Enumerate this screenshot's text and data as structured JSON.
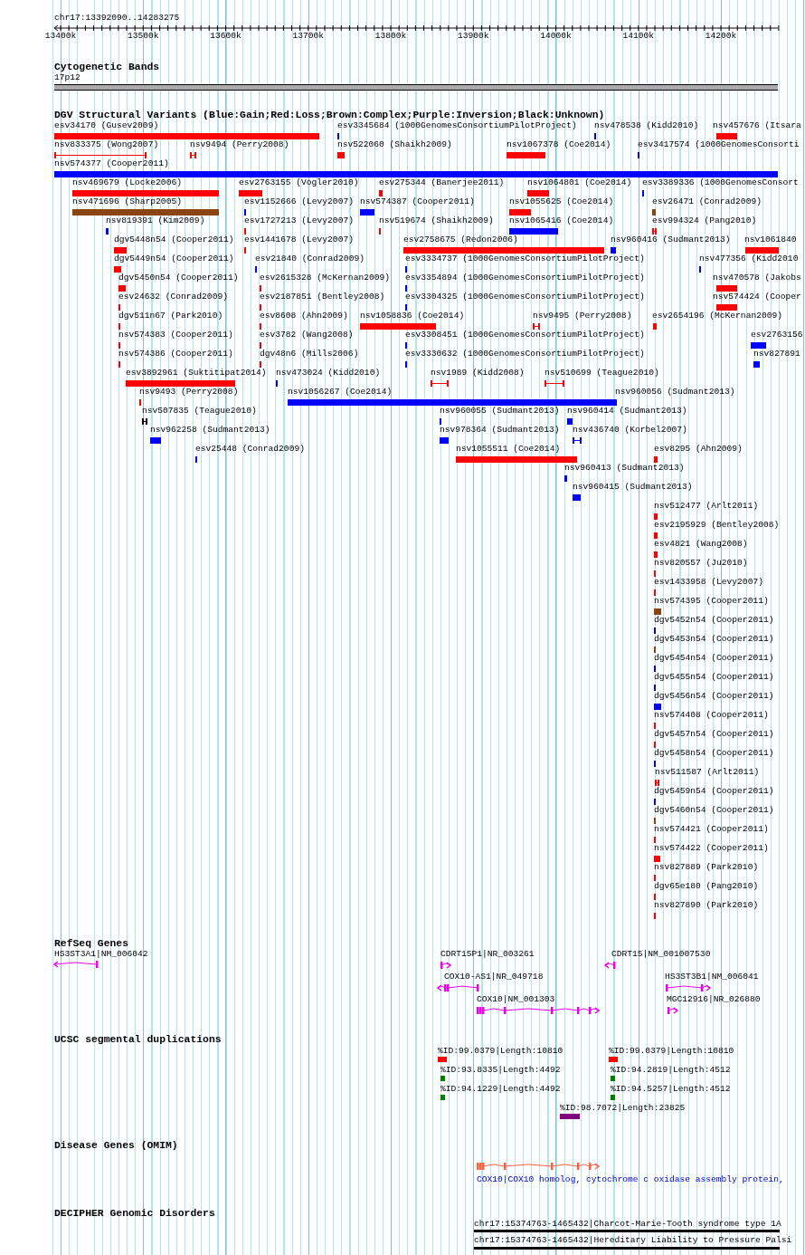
{
  "position": "chr17:13392090..14283275",
  "ruler": {
    "ticks": [
      "13400k",
      "13500k",
      "13600k",
      "13700k",
      "13800k",
      "13900k",
      "14000k",
      "14100k",
      "14200k"
    ]
  },
  "cytogenetic_bands": {
    "title": "Cytogenetic Bands",
    "bands": [
      {
        "label": "17p12"
      }
    ]
  },
  "dgv_variants": {
    "title": "DGV Structural Variants (Blue:Gain;Red:Loss;Brown:Complex;Purple:Inversion;Black:Unknown)",
    "rows": [
      [
        {
          "label": "esv34170 (Gusev2009)",
          "color": "#ff0000"
        },
        {
          "label": "esv3345684 (1000GenomesConsortiumPilotProject)",
          "color": "#0000ff"
        },
        {
          "label": "nsv478538 (Kidd2010)",
          "color": "#0000ff"
        },
        {
          "label": "nsv457676 (Itsara",
          "color": "#ff0000"
        }
      ],
      [
        {
          "label": "nsv833375 (Wong2007)",
          "color": "#ff0000"
        },
        {
          "label": "nsv9494 (Perry2008)",
          "color": "#ff0000"
        },
        {
          "label": "nsv522060 (Shaikh2009)",
          "color": "#ff0000"
        },
        {
          "label": "nsv1067378 (Coe2014)",
          "color": "#ff0000"
        },
        {
          "label": "esv3417574 (1000GenomesConsorti",
          "color": "#0000ff"
        }
      ],
      [
        {
          "label": "nsv574377 (Cooper2011)",
          "color": "#0000ff"
        }
      ],
      [
        {
          "label": "nsv469679 (Locke2006)",
          "color": "#ff0000"
        },
        {
          "label": "esv2763155 (Vogler2010)",
          "color": "#ff0000"
        },
        {
          "label": "esv275344 (Banerjee2011)",
          "color": "#ff0000"
        },
        {
          "label": "nsv1064801 (Coe2014)",
          "color": "#ff0000"
        },
        {
          "label": "esv3389336 (1000GenomesConsort",
          "color": "#0000ff"
        }
      ],
      [
        {
          "label": "nsv471696 (Sharp2005)",
          "color": "#8b4513"
        },
        {
          "label": "esv1152666 (Levy2007)",
          "color": "#0000ff"
        },
        {
          "label": "nsv574387 (Cooper2011)",
          "color": "#0000ff"
        },
        {
          "label": "nsv1055625 (Coe2014)",
          "color": "#ff0000"
        },
        {
          "label": "esv26471 (Conrad2009)",
          "color": "#8b4513"
        }
      ],
      [
        {
          "label": "nsv819391 (Kim2009)",
          "color": "#0000ff"
        },
        {
          "label": "esv1727213 (Levy2007)",
          "color": "#ff0000"
        },
        {
          "label": "nsv519674 (Shaikh2009)",
          "color": "#ff0000"
        },
        {
          "label": "nsv1065416 (Coe2014)",
          "color": "#0000ff"
        },
        {
          "label": "esv994324 (Pang2010)",
          "color": "#ff0000"
        }
      ],
      [
        {
          "label": "dgv5448n54 (Cooper2011)",
          "color": "#ff0000"
        },
        {
          "label": "esv1441678 (Levy2007)",
          "color": "#ff0000"
        },
        {
          "label": "esv2758675 (Redon2006)",
          "color": "#ff0000"
        },
        {
          "label": "nsv960416 (Sudmant2013)",
          "color": "#0000ff"
        },
        {
          "label": "nsv1061840",
          "color": "#ff0000"
        }
      ],
      [
        {
          "label": "dgv5449n54 (Cooper2011)",
          "color": "#ff0000"
        },
        {
          "label": "esv21840 (Conrad2009)",
          "color": "#0000ff"
        },
        {
          "label": "esv3334737 (1000GenomesConsortiumPilotProject)",
          "color": "#0000ff"
        },
        {
          "label": "nsv477356 (Kidd2010",
          "color": "#0000ff"
        }
      ],
      [
        {
          "label": "dgv5450n54 (Cooper2011)",
          "color": "#ff0000"
        },
        {
          "label": "esv2615328 (McKernan2009)",
          "color": "#ff0000"
        },
        {
          "label": "esv3354894 (1000GenomesConsortiumPilotProject)",
          "color": "#0000ff"
        },
        {
          "label": "nsv470578 (Jakobs",
          "color": "#ff0000"
        }
      ],
      [
        {
          "label": "esv24632 (Conrad2009)",
          "color": "#ff0000"
        },
        {
          "label": "esv2187851 (Bentley2008)",
          "color": "#ff0000"
        },
        {
          "label": "esv3304325 (1000GenomesConsortiumPilotProject)",
          "color": "#0000ff"
        },
        {
          "label": "nsv574424 (Cooper",
          "color": "#ff0000"
        }
      ],
      [
        {
          "label": "dgv511n67 (Park2010)",
          "color": "#ff0000"
        },
        {
          "label": "esv8608 (Ahn2009)",
          "color": "#ff0000"
        },
        {
          "label": "nsv1058836 (Coe2014)",
          "color": "#ff0000"
        },
        {
          "label": "nsv9495 (Perry2008)",
          "color": "#ff0000"
        },
        {
          "label": "esv2654196 (McKernan2009)",
          "color": "#ff0000"
        }
      ],
      [
        {
          "label": "nsv574383 (Cooper2011)",
          "color": "#ff0000"
        },
        {
          "label": "esv3782 (Wang2008)",
          "color": "#ff0000"
        },
        {
          "label": "esv3308451 (1000GenomesConsortiumPilotProject)",
          "color": "#0000ff"
        },
        {
          "label": "esv2763156",
          "color": "#0000ff"
        }
      ],
      [
        {
          "label": "nsv574386 (Cooper2011)",
          "color": "#ff0000"
        },
        {
          "label": "dgv48n6 (Mills2006)",
          "color": "#ff0000"
        },
        {
          "label": "esv3330632 (1000GenomesConsortiumPilotProject)",
          "color": "#0000ff"
        },
        {
          "label": "nsv827891",
          "color": "#0000ff"
        }
      ],
      [
        {
          "label": "esv3892961 (Suktitipat2014)",
          "color": "#ff0000"
        },
        {
          "label": "nsv473024 (Kidd2010)",
          "color": "#0000ff"
        },
        {
          "label": "nsv1989 (Kidd2008)",
          "color": "#ff0000"
        },
        {
          "label": "nsv510699 (Teague2010)",
          "color": "#ff0000"
        }
      ],
      [
        {
          "label": "nsv9493 (Perry2008)",
          "color": "#ff0000"
        },
        {
          "label": "nsv1056267 (Coe2014)",
          "color": "#0000ff"
        },
        {
          "label": "nsv960056 (Sudmant2013)",
          "color": "#0000ff"
        }
      ],
      [
        {
          "label": "nsv507835 (Teague2010)",
          "color": "#000000"
        },
        {
          "label": "nsv960055 (Sudmant2013)",
          "color": "#0000ff"
        },
        {
          "label": "nsv960414 (Sudmant2013)",
          "color": "#0000ff"
        }
      ],
      [
        {
          "label": "nsv962258 (Sudmant2013)",
          "color": "#0000ff"
        },
        {
          "label": "nsv978364 (Sudmant2013)",
          "color": "#0000ff"
        },
        {
          "label": "nsv436740 (Korbel2007)",
          "color": "#0000ff"
        }
      ],
      [
        {
          "label": "esv25448 (Conrad2009)",
          "color": "#0000ff"
        },
        {
          "label": "nsv1055511 (Coe2014)",
          "color": "#ff0000"
        },
        {
          "label": "esv8295 (Ahn2009)",
          "color": "#ff0000"
        }
      ],
      [
        {
          "label": "nsv960413 (Sudmant2013)",
          "color": "#0000ff"
        }
      ],
      [
        {
          "label": "nsv960415 (Sudmant2013)",
          "color": "#0000ff"
        }
      ],
      [
        {
          "label": "nsv512477 (Arlt2011)",
          "color": "#ff0000"
        }
      ],
      [
        {
          "label": "esv2195929 (Bentley2008)",
          "color": "#ff0000"
        }
      ],
      [
        {
          "label": "esv4821 (Wang2008)",
          "color": "#ff0000"
        }
      ],
      [
        {
          "label": "nsv820557 (Ju2010)",
          "color": "#ff0000"
        }
      ],
      [
        {
          "label": "esv1433958 (Levy2007)",
          "color": "#ff0000"
        }
      ],
      [
        {
          "label": "nsv574395 (Cooper2011)",
          "color": "#8b4513"
        }
      ],
      [
        {
          "label": "dgv5452n54 (Cooper2011)",
          "color": "#0000ff"
        }
      ],
      [
        {
          "label": "dgv5453n54 (Cooper2011)",
          "color": "#8b4513"
        }
      ],
      [
        {
          "label": "dgv5454n54 (Cooper2011)",
          "color": "#0000ff"
        }
      ],
      [
        {
          "label": "dgv5455n54 (Cooper2011)",
          "color": "#0000ff"
        }
      ],
      [
        {
          "label": "dgv5456n54 (Cooper2011)",
          "color": "#0000ff"
        }
      ],
      [
        {
          "label": "nsv574408 (Cooper2011)",
          "color": "#ff0000"
        }
      ],
      [
        {
          "label": "dgv5457n54 (Cooper2011)",
          "color": "#ff0000"
        }
      ],
      [
        {
          "label": "dgv5458n54 (Cooper2011)",
          "color": "#0000ff"
        }
      ],
      [
        {
          "label": "nsv511587 (Arlt2011)",
          "color": "#ff0000"
        }
      ],
      [
        {
          "label": "dgv5459n54 (Cooper2011)",
          "color": "#0000ff"
        }
      ],
      [
        {
          "label": "dgv5460n54 (Cooper2011)",
          "color": "#8b4513"
        }
      ],
      [
        {
          "label": "nsv574421 (Cooper2011)",
          "color": "#ff0000"
        }
      ],
      [
        {
          "label": "nsv574422 (Cooper2011)",
          "color": "#ff0000"
        }
      ],
      [
        {
          "label": "nsv827889 (Park2010)",
          "color": "#ff0000"
        }
      ],
      [
        {
          "label": "dgv65e180 (Pang2010)",
          "color": "#ff0000"
        }
      ],
      [
        {
          "label": "nsv827890 (Park2010)",
          "color": "#ff0000"
        }
      ]
    ]
  },
  "refseq_genes": {
    "title": "RefSeq Genes",
    "genes": [
      {
        "label": "HS3ST3A1|NM_006042",
        "reverse": true
      },
      {
        "label": "CDRT15P1|NR_003261",
        "reverse": false
      },
      {
        "label": "CDRT15|NM_001007530",
        "reverse": true
      },
      {
        "label": "COX10-AS1|NR_049718",
        "reverse": true
      },
      {
        "label": "HS3ST3B1|NM_006041",
        "reverse": false
      },
      {
        "label": "COX10|NM_001303",
        "reverse": false
      },
      {
        "label": "MGC12916|NR_026880",
        "reverse": false
      }
    ]
  },
  "segmental_duplications": {
    "title": "UCSC segmental duplications",
    "items": [
      {
        "label": "%ID:99.0379|Length:10810",
        "color": "#ff0000"
      },
      {
        "label": "%ID:99.0379|Length:10810",
        "color": "#ff0000"
      },
      {
        "label": "%ID:93.8335|Length:4492",
        "color": "#008000"
      },
      {
        "label": "%ID:94.2819|Length:4512",
        "color": "#008000"
      },
      {
        "label": "%ID:94.1229|Length:4492",
        "color": "#008000"
      },
      {
        "label": "%ID:94.5257|Length:4512",
        "color": "#008000"
      },
      {
        "label": "%ID:98.7072|Length:23825",
        "color": "#800080"
      }
    ]
  },
  "disease_genes": {
    "title": "Disease Genes (OMIM)",
    "genes": [
      {
        "label": "COX10|COX10 homolog, cytochrome c oxidase assembly protein,",
        "reverse": false
      }
    ]
  },
  "decipher": {
    "title": "DECIPHER Genomic Disorders",
    "items": [
      {
        "label": "chr17:15374763-1465432|Charcot-Marie-Tooth syndrome type 1A"
      },
      {
        "label": "chr17:15374763-1465432|Hereditary Liability to Pressure Palsi"
      }
    ]
  }
}
